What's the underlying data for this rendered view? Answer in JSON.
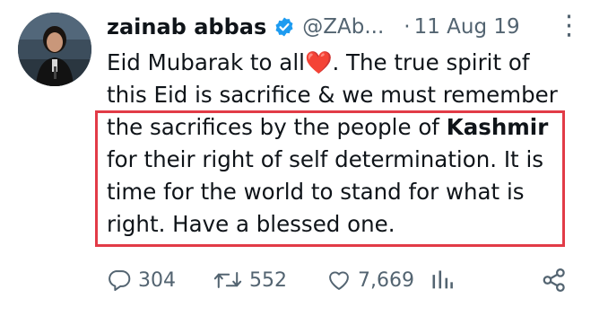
{
  "tweet": {
    "author_name": "zainab abbas",
    "handle": "@ZAb...",
    "separator": "·",
    "date": "11 Aug 19",
    "more_icon": "⋮",
    "text_lines": [
      [
        "Eid Mubarak to all",
        "❤️",
        ". The true spirit of"
      ],
      "this Eid is sacrifice & we must remember",
      [
        "the sacrifices by the people of ",
        "Kashmir"
      ],
      "for their right of self determination. It is",
      "time for the world to stand for what is",
      "right. Have a blessed one."
    ],
    "actions": {
      "replies": "304",
      "retweets": "552",
      "likes": "7,669"
    }
  },
  "icons": {
    "verified": "verified-badge-icon",
    "reply": "reply-icon",
    "retweet": "retweet-icon",
    "like": "heart-icon",
    "views": "analytics-icon",
    "share": "share-icon"
  },
  "colors": {
    "text": "#0f1419",
    "muted": "#536471",
    "verified": "#1d9bf0",
    "highlight_border": "#e23b47",
    "heart": "#e0245e"
  }
}
